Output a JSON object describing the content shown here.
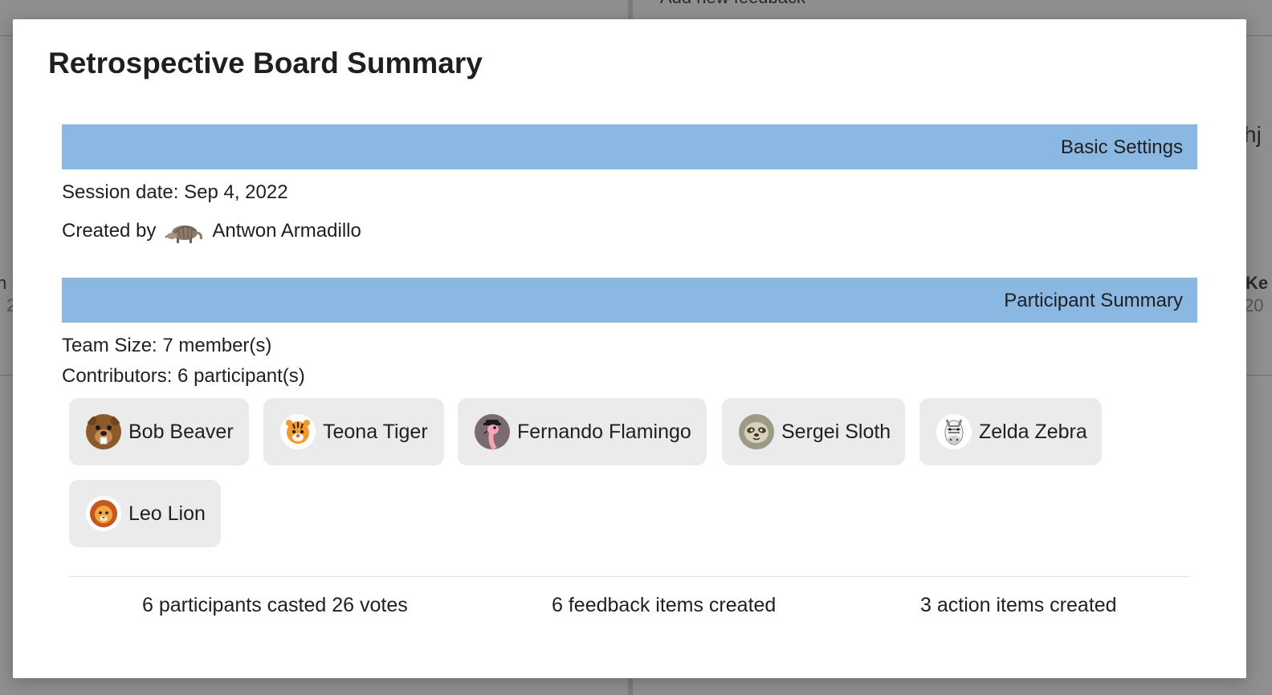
{
  "background": {
    "add_feedback_label": "Add new feedback",
    "right_fragment_1": "hj",
    "right_fragment_2": "Ke",
    "right_fragment_3": "20",
    "left_fragment_1": "n l",
    "left_fragment_2": "2"
  },
  "modal": {
    "title": "Retrospective Board Summary",
    "basic_settings": {
      "header": "Basic Settings",
      "session_date": "Session date: Sep 4, 2022",
      "created_by_label": "Created by",
      "creator_name": "Antwon Armadillo",
      "creator_icon": "armadillo-icon"
    },
    "participant_summary": {
      "header": "Participant Summary",
      "team_size": "Team Size: 7 member(s)",
      "contributors": "Contributors: 6 participant(s)",
      "participants": [
        {
          "name": "Bob Beaver",
          "icon": "beaver-icon"
        },
        {
          "name": "Teona Tiger",
          "icon": "tiger-icon"
        },
        {
          "name": "Fernando Flamingo",
          "icon": "flamingo-icon"
        },
        {
          "name": "Sergei Sloth",
          "icon": "sloth-icon"
        },
        {
          "name": "Zelda Zebra",
          "icon": "zebra-icon"
        },
        {
          "name": "Leo Lion",
          "icon": "lion-icon"
        }
      ]
    },
    "stats": {
      "votes": "6 participants casted 26 votes",
      "feedback": "6 feedback items created",
      "actions": "3 action items created"
    }
  },
  "colors": {
    "section_header": "#8ab8e3",
    "chip_background": "#ebebeb",
    "overlay": "#8f8f8f"
  }
}
